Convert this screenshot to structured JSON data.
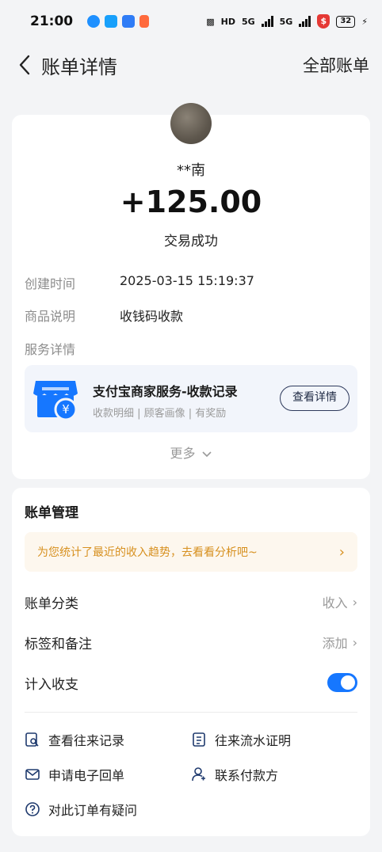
{
  "status_bar": {
    "time": "21:00",
    "net_labels": [
      "5G",
      "5G"
    ],
    "battery": "32"
  },
  "nav": {
    "title": "账单详情",
    "right_link": "全部账单"
  },
  "transaction": {
    "payer": "**南",
    "amount": "+125.00",
    "status": "交易成功",
    "rows": [
      {
        "label": "创建时间",
        "value": "2025-03-15 15:19:37"
      },
      {
        "label": "商品说明",
        "value": "收钱码收款"
      },
      {
        "label": "服务详情",
        "value": ""
      }
    ],
    "service": {
      "title": "支付宝商家服务-收款记录",
      "subtitle": "收款明细 | 顾客画像 | 有奖励",
      "button": "查看详情"
    },
    "more": "更多"
  },
  "management": {
    "title": "账单管理",
    "banner": "为您统计了最近的收入趋势，去看看分析吧~",
    "rows": [
      {
        "label": "账单分类",
        "value": "收入"
      },
      {
        "label": "标签和备注",
        "value": "添加"
      },
      {
        "label": "计入收支",
        "value": ""
      }
    ],
    "links": [
      {
        "label": "查看往来记录",
        "icon": "search-record-icon"
      },
      {
        "label": "往来流水证明",
        "icon": "document-icon"
      },
      {
        "label": "申请电子回单",
        "icon": "mail-icon"
      },
      {
        "label": "联系付款方",
        "icon": "contact-user-icon"
      },
      {
        "label": "对此订单有疑问",
        "icon": "question-icon"
      }
    ]
  },
  "colors": {
    "accent": "#1677ff",
    "banner_text": "#d7901f",
    "shop_icon": "#1677ff"
  }
}
